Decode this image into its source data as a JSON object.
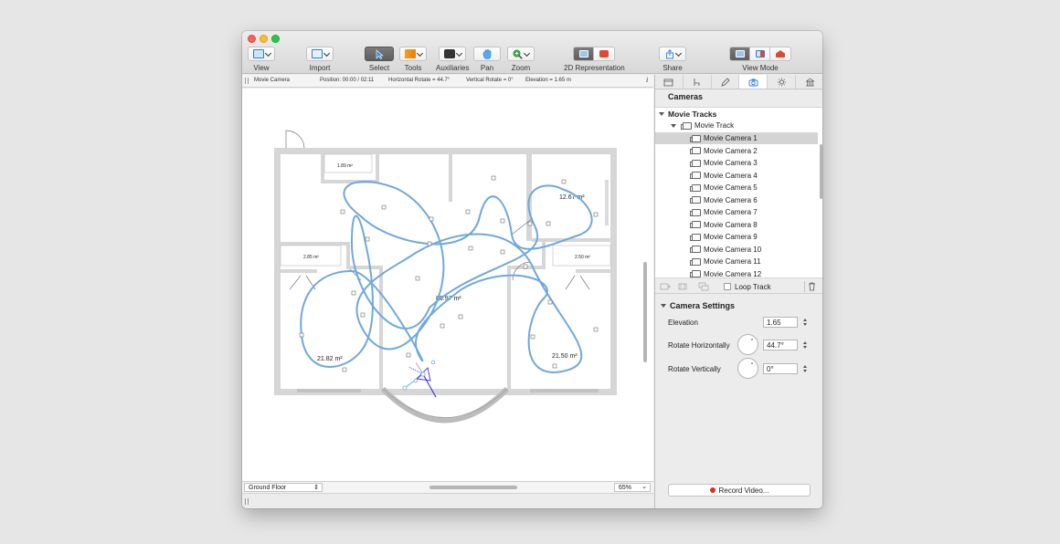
{
  "toolbar": {
    "view": "View",
    "import": "Import",
    "select": "Select",
    "tools": "Tools",
    "auxiliaries": "Auxiliaries",
    "pan": "Pan",
    "zoom": "Zoom",
    "representation": "2D Representation",
    "share": "Share",
    "view_mode": "View Mode"
  },
  "status": {
    "object": "Movie Camera",
    "position": "Position: 00:00 / 02:11",
    "h_rotate": "Horizontal Rotate = 44.7°",
    "v_rotate": "Vertical Rotate = 0°",
    "elevation": "Elevation = 1.65 m"
  },
  "plan": {
    "rooms": [
      "1.89 m²",
      "12.67 m²",
      "2.85 m²",
      "80.97 m²",
      "2.50 m²",
      "21.82 m²",
      "21.50 m²"
    ]
  },
  "bottom": {
    "floor": "Ground Floor",
    "zoom": "65%"
  },
  "panel": {
    "title": "Cameras",
    "movie_tracks": "Movie Tracks",
    "track": "Movie Track",
    "cameras": [
      "Movie Camera 1",
      "Movie Camera 2",
      "Movie Camera 3",
      "Movie Camera 4",
      "Movie Camera 5",
      "Movie Camera 6",
      "Movie Camera 7",
      "Movie Camera 8",
      "Movie Camera 9",
      "Movie Camera 10",
      "Movie Camera 11",
      "Movie Camera 12"
    ],
    "loop_track": "Loop Track",
    "settings_title": "Camera Settings",
    "elevation_label": "Elevation",
    "elevation_value": "1.65",
    "rot_h_label": "Rotate Horizontally",
    "rot_h_value": "44.7°",
    "rot_v_label": "Rotate Vertically",
    "rot_v_value": "0°",
    "record": "Record Video..."
  },
  "colors": {
    "path": "#6fa8dc",
    "camera": "#3b3bd6",
    "accent_record": "#e82a1c"
  }
}
